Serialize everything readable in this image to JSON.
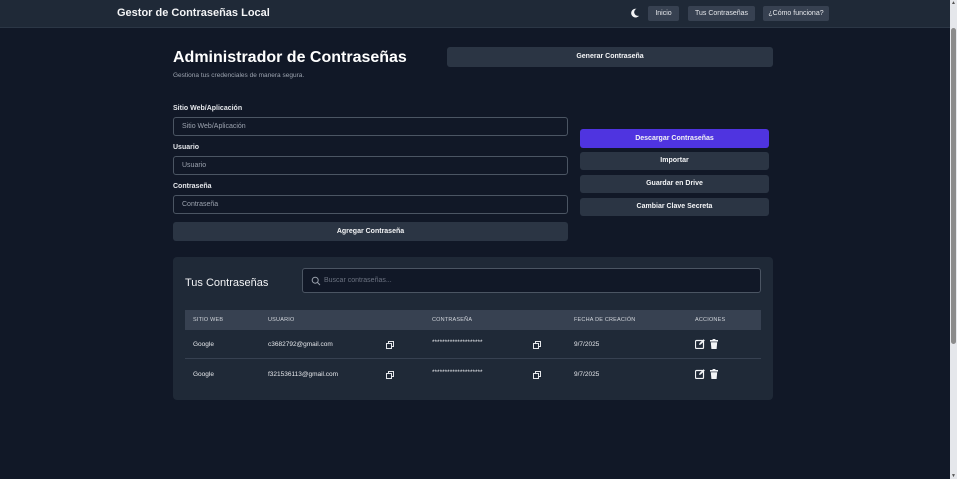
{
  "navbar": {
    "brand": "Gestor de Contraseñas Local",
    "theme_icon": "moon-icon",
    "links": [
      "Inicio",
      "Tus Contraseñas",
      "¿Cómo funciona?"
    ]
  },
  "header": {
    "title": "Administrador de Contraseñas",
    "subtitle": "Gestiona tus credenciales de manera segura.",
    "generate_label": "Generar Contraseña"
  },
  "form": {
    "site_label": "Sitio Web/Aplicación",
    "site_placeholder": "Sitio Web/Aplicación",
    "user_label": "Usuario",
    "user_placeholder": "Usuario",
    "password_label": "Contraseña",
    "password_placeholder": "Contraseña",
    "add_label": "Agregar Contraseña"
  },
  "actions": {
    "download": "Descargar Contraseñas",
    "import": "Importar",
    "drive": "Guardar en Drive",
    "secret": "Cambiar Clave Secreta"
  },
  "passwords": {
    "title": "Tus Contraseñas",
    "search_placeholder": "Buscar contraseñas...",
    "columns": [
      "SITIO WEB",
      "USUARIO",
      "CONTRASEÑA",
      "FECHA DE CREACIÓN",
      "ACCIONES"
    ],
    "rows": [
      {
        "site": "Google",
        "user": "c3682792@gmail.com",
        "password": "********************",
        "date": "9/7/2025"
      },
      {
        "site": "Google",
        "user": "f321536113@gmail.com",
        "password": "********************",
        "date": "9/7/2025"
      }
    ]
  },
  "colors": {
    "background": "#111827",
    "surface": "#1f2937",
    "button": "#2b3544",
    "accent": "#4f34e0"
  }
}
